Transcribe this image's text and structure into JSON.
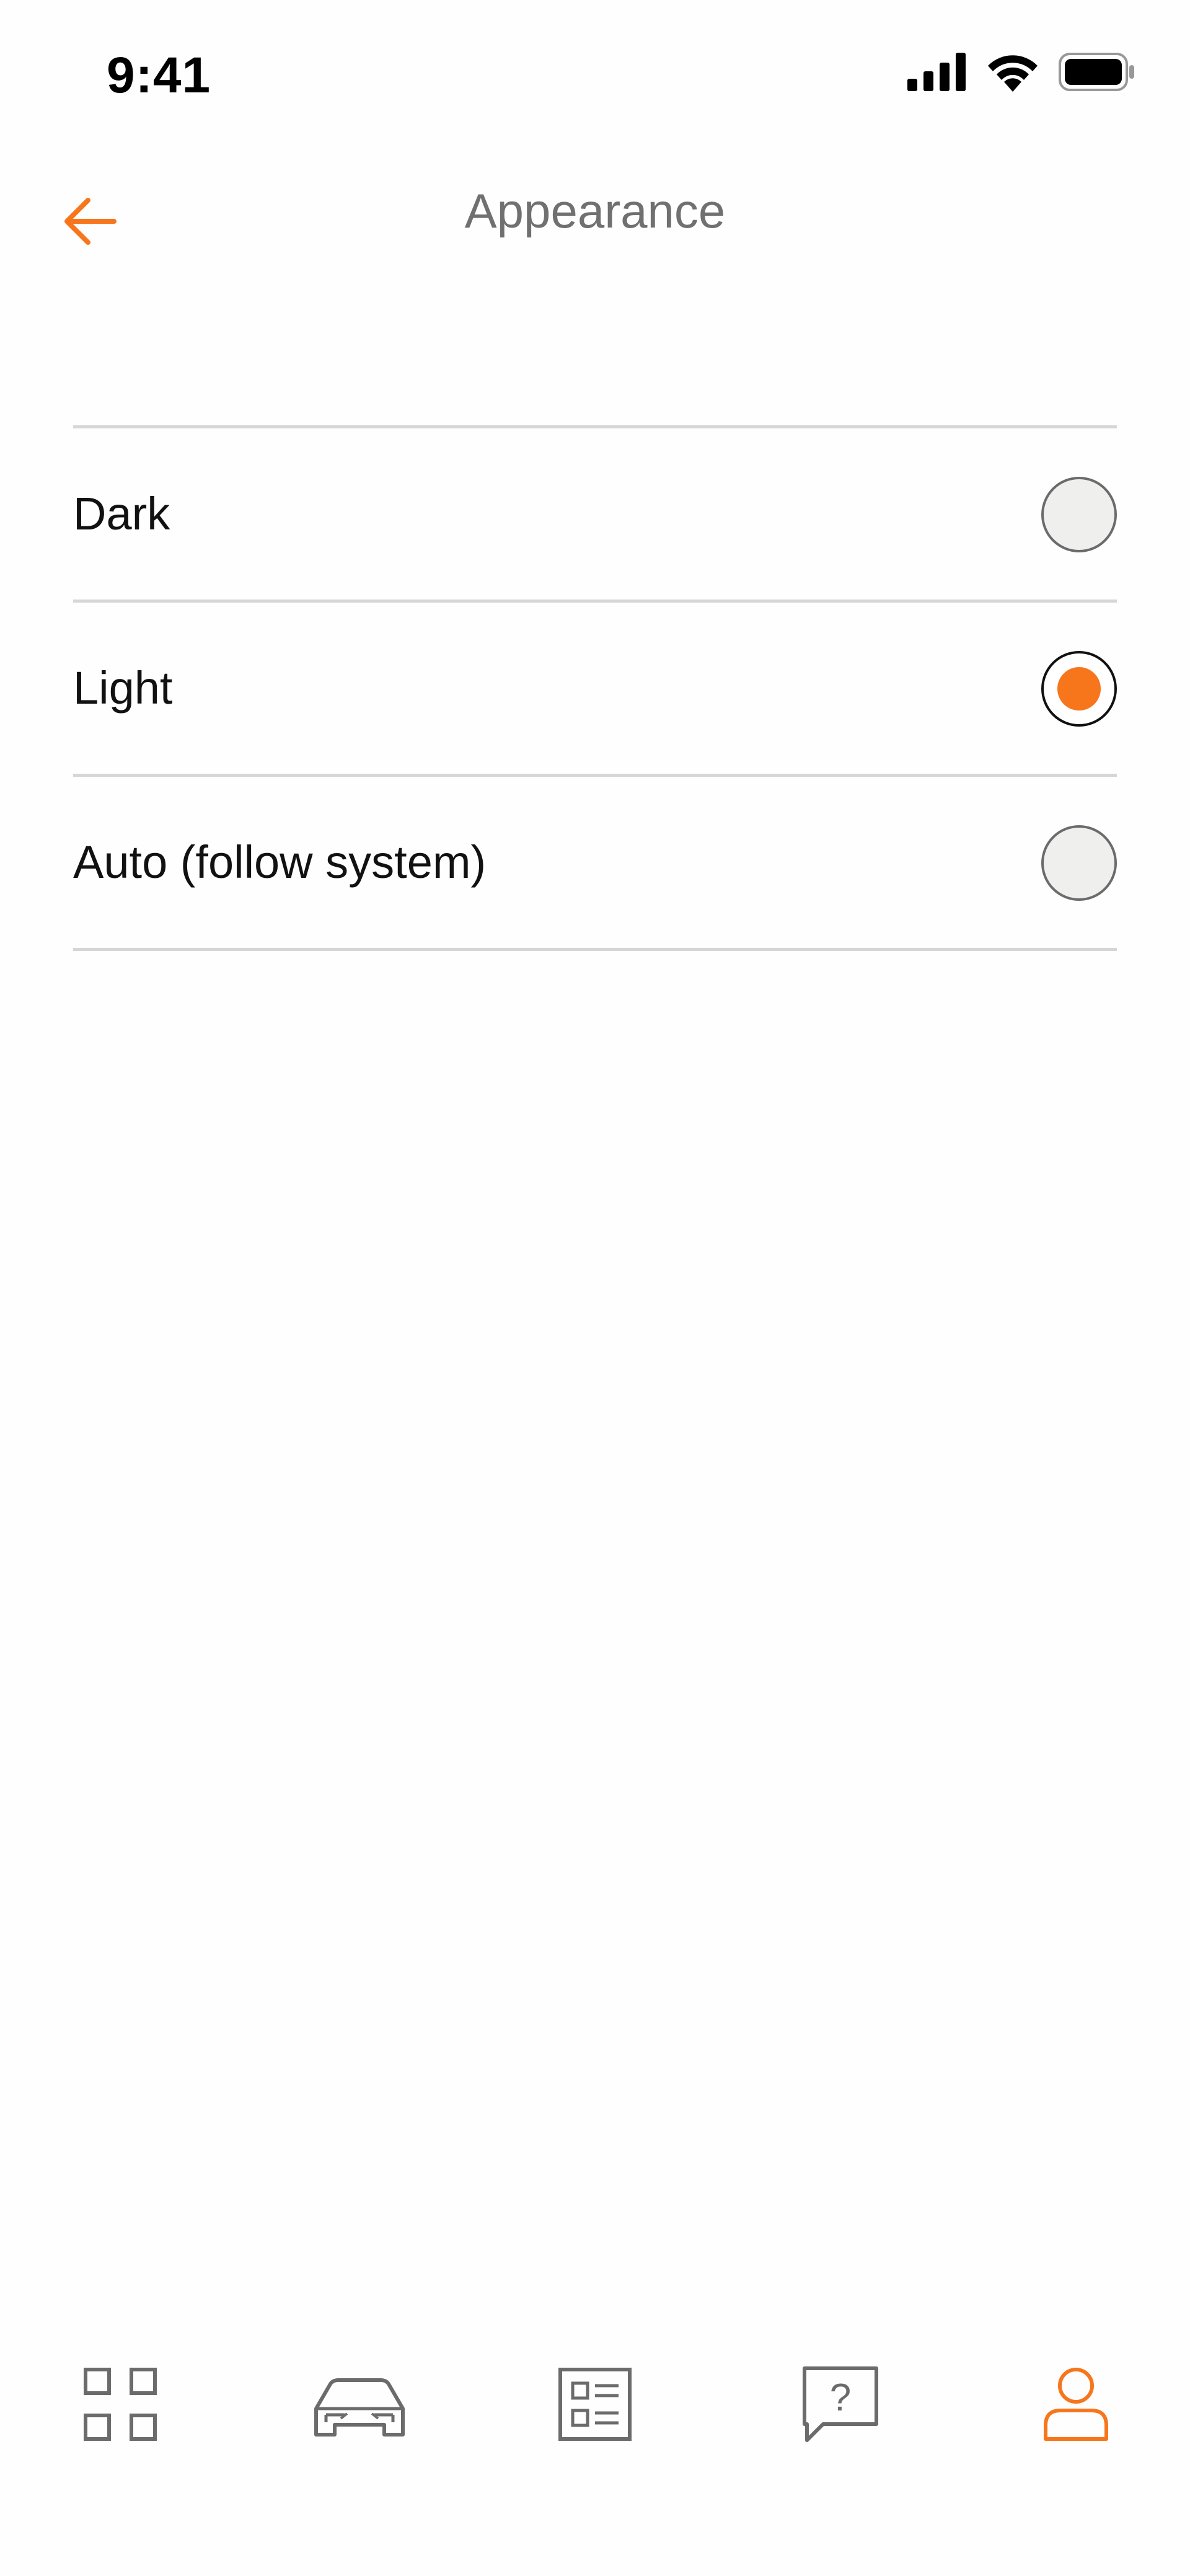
{
  "status_bar": {
    "time": "9:41",
    "icons": [
      "cellular-signal-icon",
      "wifi-icon",
      "battery-icon"
    ]
  },
  "header": {
    "back_icon": "arrow-left-icon",
    "title": "Appearance"
  },
  "appearance": {
    "selected": "light",
    "options": [
      {
        "id": "dark",
        "label": "Dark",
        "selected": false
      },
      {
        "id": "light",
        "label": "Light",
        "selected": true
      },
      {
        "id": "auto",
        "label": "Auto (follow system)",
        "selected": false
      }
    ]
  },
  "tab_bar": {
    "tabs": [
      {
        "id": "dashboard",
        "icon": "grid-icon",
        "active": false
      },
      {
        "id": "car",
        "icon": "car-icon",
        "active": false
      },
      {
        "id": "list",
        "icon": "list-icon",
        "active": false
      },
      {
        "id": "help",
        "icon": "help-chat-icon",
        "active": false
      },
      {
        "id": "profile",
        "icon": "user-icon",
        "active": true
      }
    ]
  },
  "colors": {
    "accent": "#f7761c",
    "background": "#fefefe",
    "divider": "#d6d6d6",
    "title": "#707070",
    "inactive_icon": "#6b6b6b",
    "radio_fill": "#efefed"
  }
}
